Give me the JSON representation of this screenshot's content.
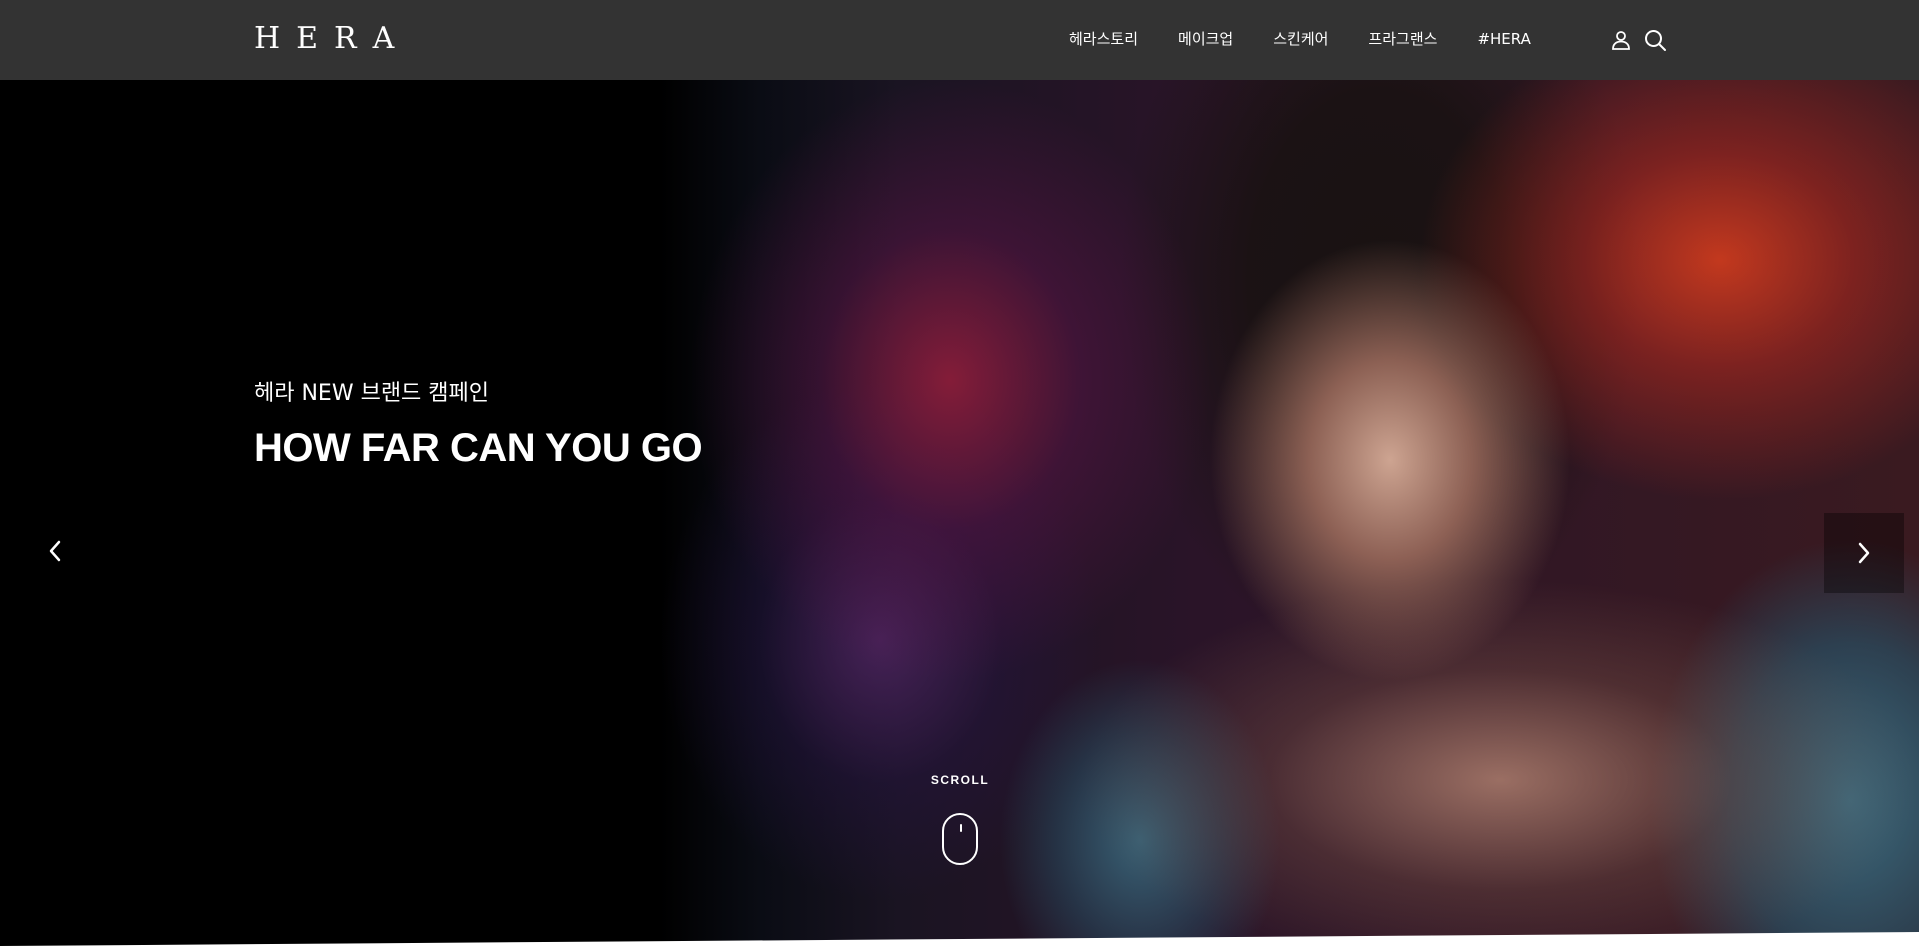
{
  "header": {
    "logo": "HERA",
    "nav": [
      {
        "label": "헤라스토리"
      },
      {
        "label": "메이크업"
      },
      {
        "label": "스킨케어"
      },
      {
        "label": "프라그랜스"
      },
      {
        "label": "#HERA"
      }
    ],
    "icons": [
      "user-icon",
      "search-icon"
    ]
  },
  "hero": {
    "subtitle": "헤라 NEW 브랜드 캠페인",
    "title": "HOW FAR CAN YOU GO",
    "scroll_label": "SCROLL",
    "prev_icon": "chevron-left-icon",
    "next_icon": "chevron-right-icon"
  },
  "colors": {
    "header_bg": "#333333",
    "text": "#ffffff",
    "page_bg": "#ffffff"
  }
}
